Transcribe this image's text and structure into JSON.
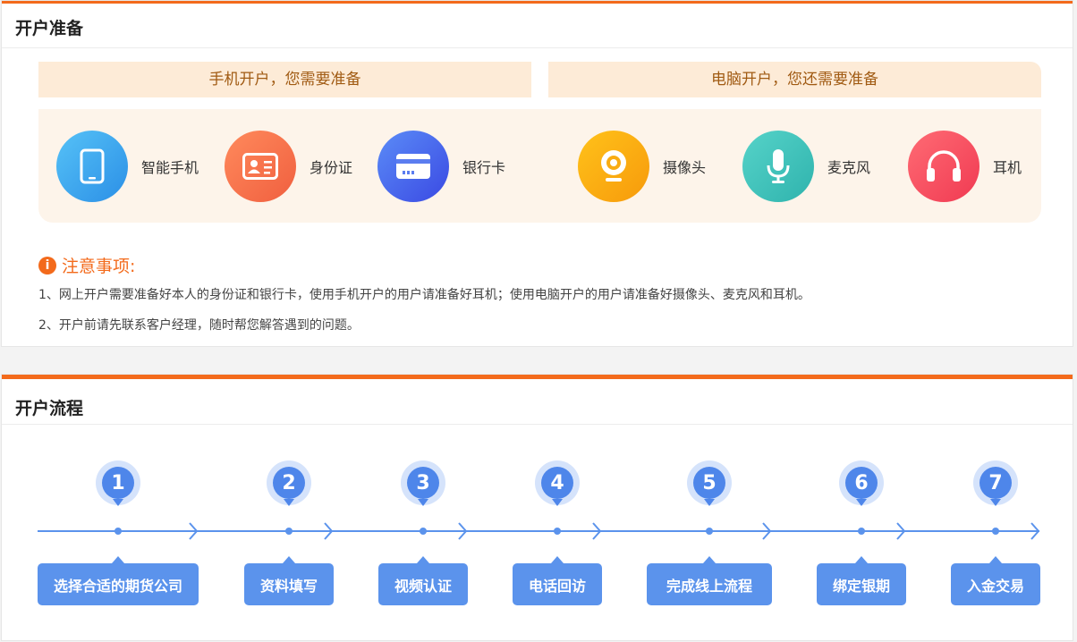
{
  "prep": {
    "title": "开户准备",
    "mobile_banner": "手机开户，您需要准备",
    "pc_banner": "电脑开户，您还需要准备",
    "items": [
      {
        "label": "智能手机",
        "icon": "smartphone-icon",
        "color": "#37a9f0"
      },
      {
        "label": "身份证",
        "icon": "id-card-icon",
        "color": "#f6774d"
      },
      {
        "label": "银行卡",
        "icon": "bank-card-icon",
        "color": "#4a67ea"
      },
      {
        "label": "摄像头",
        "icon": "webcam-icon",
        "color": "#f9a411"
      },
      {
        "label": "麦克风",
        "icon": "microphone-icon",
        "color": "#3cc1b9"
      },
      {
        "label": "耳机",
        "icon": "headphones-icon",
        "color": "#f6505f"
      }
    ],
    "notice": {
      "title": "注意事项:",
      "lines": [
        "1、网上开户需要准备好本人的身份证和银行卡，使用手机开户的用户请准备好耳机；使用电脑开户的用户请准备好摄像头、麦克风和耳机。",
        "2、开户前请先联系客户经理，随时帮您解答遇到的问题。"
      ]
    }
  },
  "flow": {
    "title": "开户流程",
    "steps": [
      {
        "num": "1",
        "label": "选择合适的期货公司"
      },
      {
        "num": "2",
        "label": "资料填写"
      },
      {
        "num": "3",
        "label": "视频认证"
      },
      {
        "num": "4",
        "label": "电话回访"
      },
      {
        "num": "5",
        "label": "完成线上流程"
      },
      {
        "num": "6",
        "label": "绑定银期"
      },
      {
        "num": "7",
        "label": "入金交易"
      }
    ]
  },
  "colors": {
    "accent": "#f36a1b",
    "flow_blue": "#5b93ec"
  }
}
